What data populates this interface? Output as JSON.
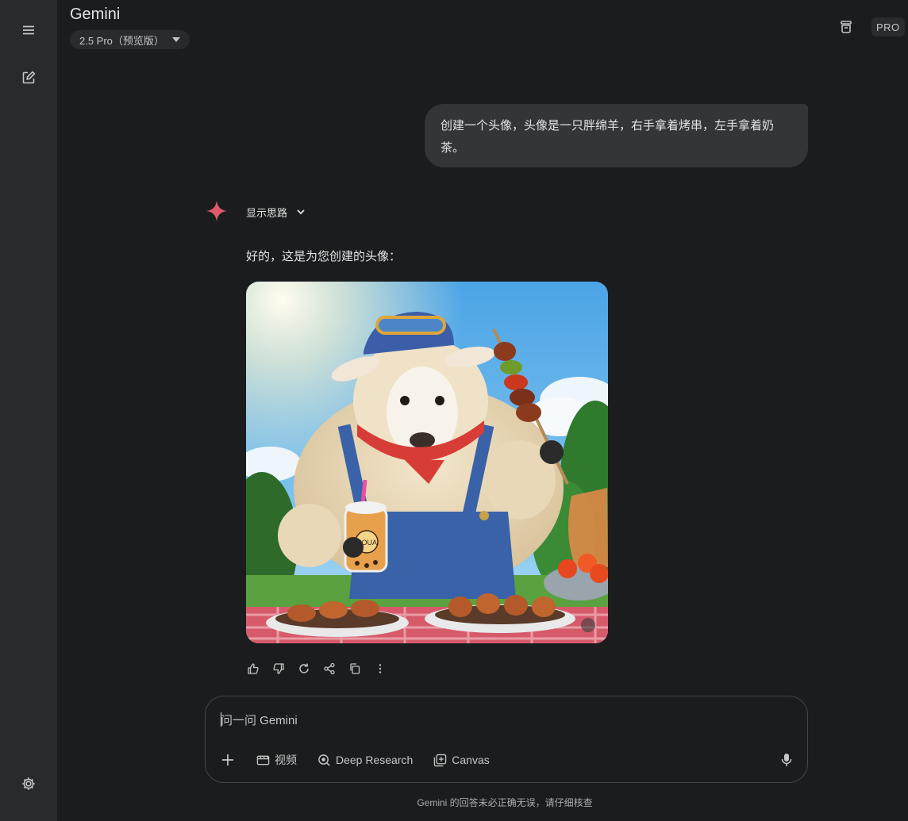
{
  "header": {
    "title": "Gemini",
    "model_label": "2.5 Pro（预览版）",
    "pro_badge": "PRO"
  },
  "sidebar": {
    "icons": [
      "menu-icon",
      "new-chat-icon",
      "settings-icon"
    ]
  },
  "conversation": {
    "user_message": "创建一个头像，头像是一只胖绵羊，右手拿着烤串，左手拿着奶茶。",
    "show_thinking_label": "显示思路",
    "response_text": "好的，这是为您创建的头像：",
    "image_cup_text": "COUA"
  },
  "response_actions": [
    "thumbs-up-icon",
    "thumbs-down-icon",
    "redo-icon",
    "share-icon",
    "copy-icon",
    "more-icon"
  ],
  "composer": {
    "placeholder": "问一问 Gemini",
    "tools": {
      "video": "视频",
      "deep_research": "Deep Research",
      "canvas": "Canvas"
    }
  },
  "footer": {
    "disclaimer": "Gemini 的回答未必正确无误，请仔细核查"
  },
  "colors": {
    "background": "#1b1c1d",
    "rail": "#282a2c",
    "bubble": "#333537",
    "spark": "#e0596a"
  }
}
